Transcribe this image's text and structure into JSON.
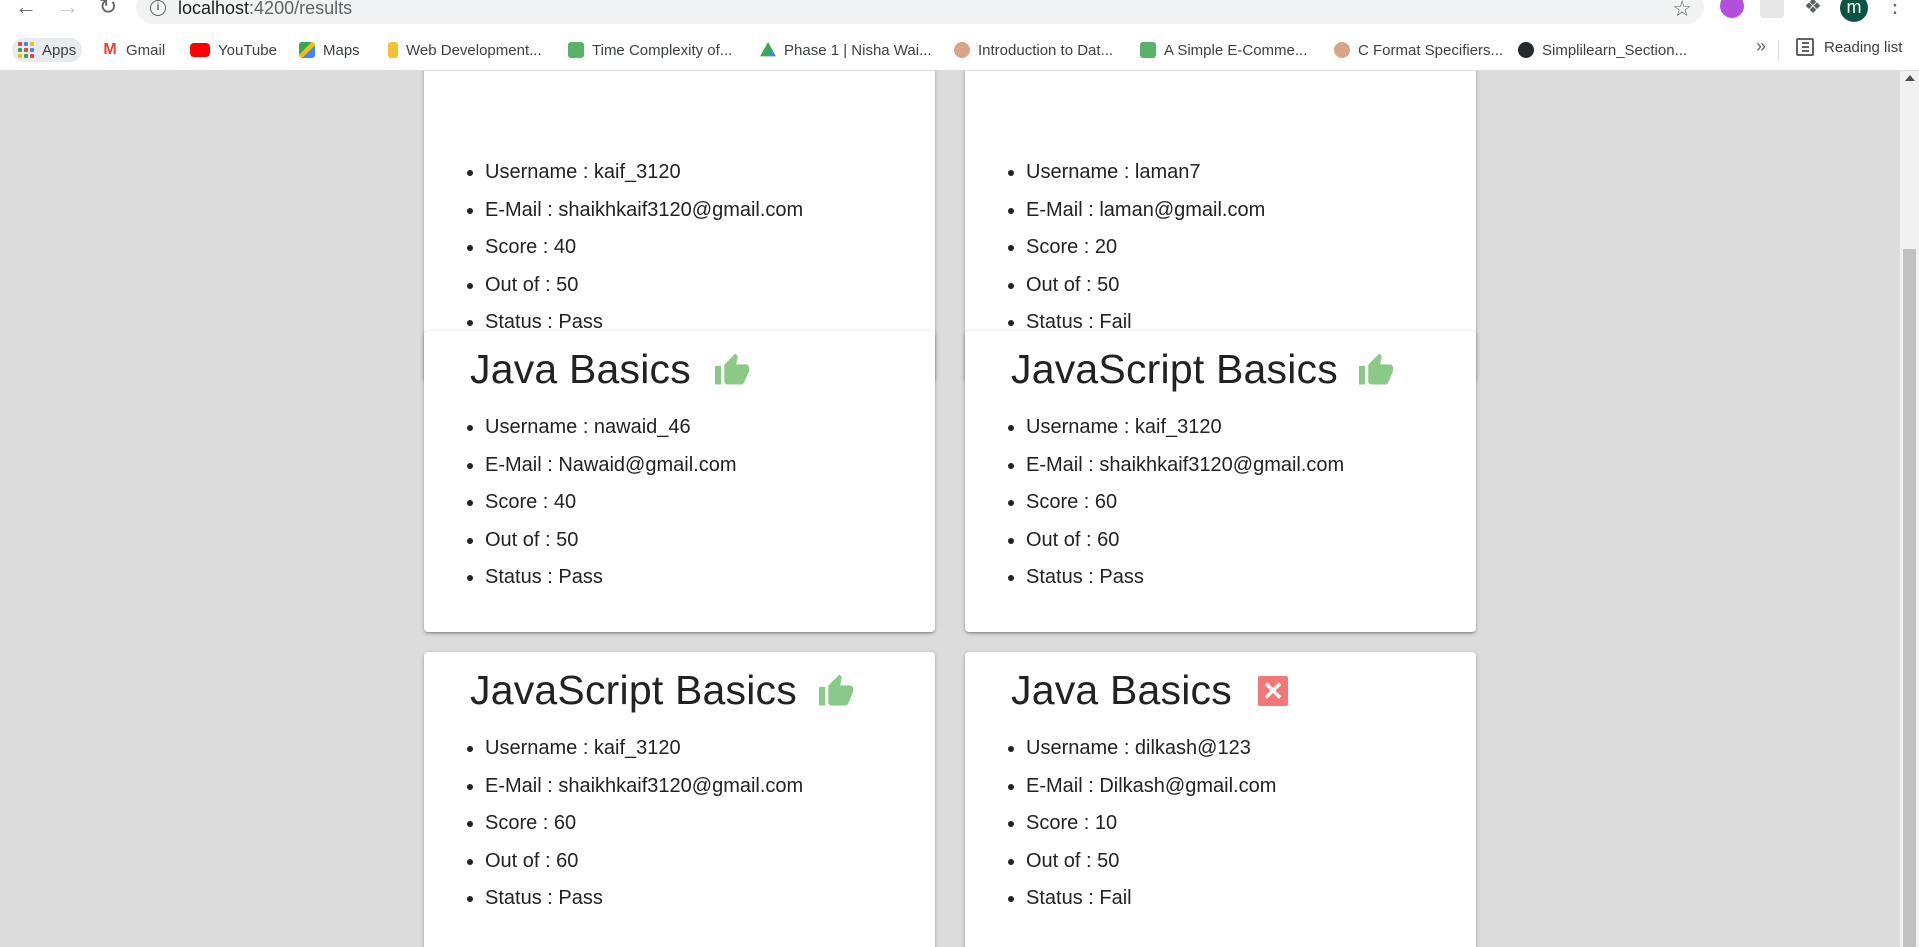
{
  "browser": {
    "url_host": "localhost",
    "url_rest": ":4200/results",
    "avatar_letter": "m",
    "bookmarks": [
      {
        "label": "Apps"
      },
      {
        "label": "Gmail"
      },
      {
        "label": "YouTube"
      },
      {
        "label": "Maps"
      },
      {
        "label": "Web Development..."
      },
      {
        "label": "Time Complexity of..."
      },
      {
        "label": "Phase 1 | Nisha Wai..."
      },
      {
        "label": "Introduction to Dat..."
      },
      {
        "label": "A Simple E-Comme..."
      },
      {
        "label": "C Format Specifiers..."
      },
      {
        "label": "Simplilearn_Section..."
      }
    ],
    "overflow_label": "»",
    "reading_list_label": "Reading list"
  },
  "results": [
    {
      "title": "",
      "status_icon": "",
      "username": "Username : kaif_3120",
      "email": "E-Mail : shaikhkaif3120@gmail.com",
      "score": "Score : 40",
      "out_of": "Out of : 50",
      "status": "Status : Pass"
    },
    {
      "title": "",
      "status_icon": "",
      "username": "Username : laman7",
      "email": "E-Mail : laman@gmail.com",
      "score": "Score : 20",
      "out_of": "Out of : 50",
      "status": "Status : Fail"
    },
    {
      "title": "Java Basics",
      "status_icon": "thumbs-up-icon",
      "username": "Username : nawaid_46",
      "email": "E-Mail : Nawaid@gmail.com",
      "score": "Score : 40",
      "out_of": "Out of : 50",
      "status": "Status : Pass"
    },
    {
      "title": "JavaScript Basics",
      "status_icon": "thumbs-up-icon",
      "username": "Username : kaif_3120",
      "email": "E-Mail : shaikhkaif3120@gmail.com",
      "score": "Score : 60",
      "out_of": "Out of : 60",
      "status": "Status : Pass"
    },
    {
      "title": "JavaScript Basics",
      "status_icon": "thumbs-up-icon",
      "username": "Username : kaif_3120",
      "email": "E-Mail : shaikhkaif3120@gmail.com",
      "score": "Score : 60",
      "out_of": "Out of : 60",
      "status": "Status : Pass"
    },
    {
      "title": "Java Basics",
      "status_icon": "close-icon",
      "username": "Username : dilkash@123",
      "email": "E-Mail : Dilkash@gmail.com",
      "score": "Score : 10",
      "out_of": "Out of : 50",
      "status": "Status : Fail"
    }
  ],
  "colors": {
    "pass_icon": "#8bc987",
    "fail_icon": "#f47676",
    "page_bg": "#dcdcdc"
  }
}
